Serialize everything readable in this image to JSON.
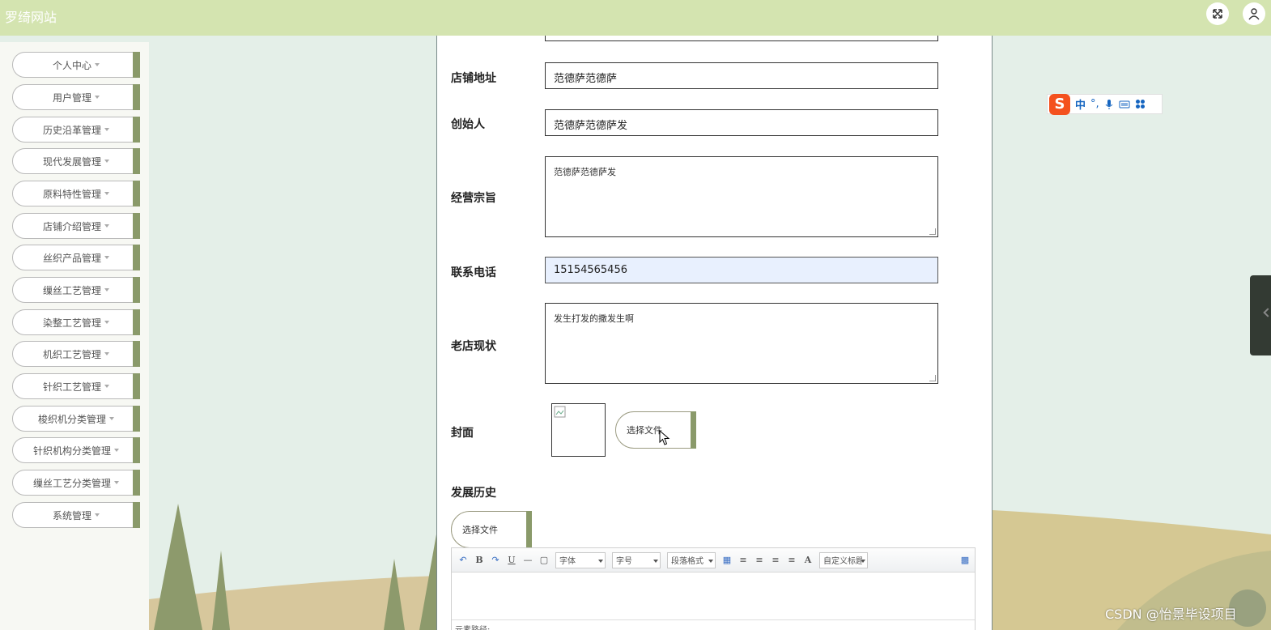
{
  "header": {
    "site_title": "罗绮网站",
    "fullscreen_icon": "expand-icon",
    "user_icon": "user-icon"
  },
  "sidebar": {
    "items": [
      {
        "label": "个人中心"
      },
      {
        "label": "用户管理"
      },
      {
        "label": "历史沿革管理"
      },
      {
        "label": "现代发展管理"
      },
      {
        "label": "原料特性管理"
      },
      {
        "label": "店铺介绍管理"
      },
      {
        "label": "丝织产品管理"
      },
      {
        "label": "缫丝工艺管理"
      },
      {
        "label": "染整工艺管理"
      },
      {
        "label": "机织工艺管理"
      },
      {
        "label": "针织工艺管理"
      },
      {
        "label": "梭织机分类管理"
      },
      {
        "label": "针织机构分类管理"
      },
      {
        "label": "缫丝工艺分类管理"
      },
      {
        "label": "系统管理"
      }
    ]
  },
  "form": {
    "address_label": "店铺地址",
    "address_value": "范德萨范德萨",
    "founder_label": "创始人",
    "founder_value": "范德萨范德萨发",
    "purpose_label": "经营宗旨",
    "purpose_value": "范德萨范德萨发",
    "phone_label": "联系电话",
    "phone_value": "15154565456",
    "status_label": "老店现状",
    "status_value": "发生打发的撒发生啊",
    "cover_label": "封面",
    "cover_file_button": "选择文件",
    "history_label": "发展历史",
    "history_file_button": "选择文件"
  },
  "editor": {
    "font_select": "字体",
    "size_select": "字号",
    "paragraph_select": "段落格式",
    "custom_title_select": "自定义标题",
    "element_path": "元素路径:"
  },
  "ime": {
    "mode": "中"
  },
  "watermark": "CSDN @怡景毕设项目"
}
